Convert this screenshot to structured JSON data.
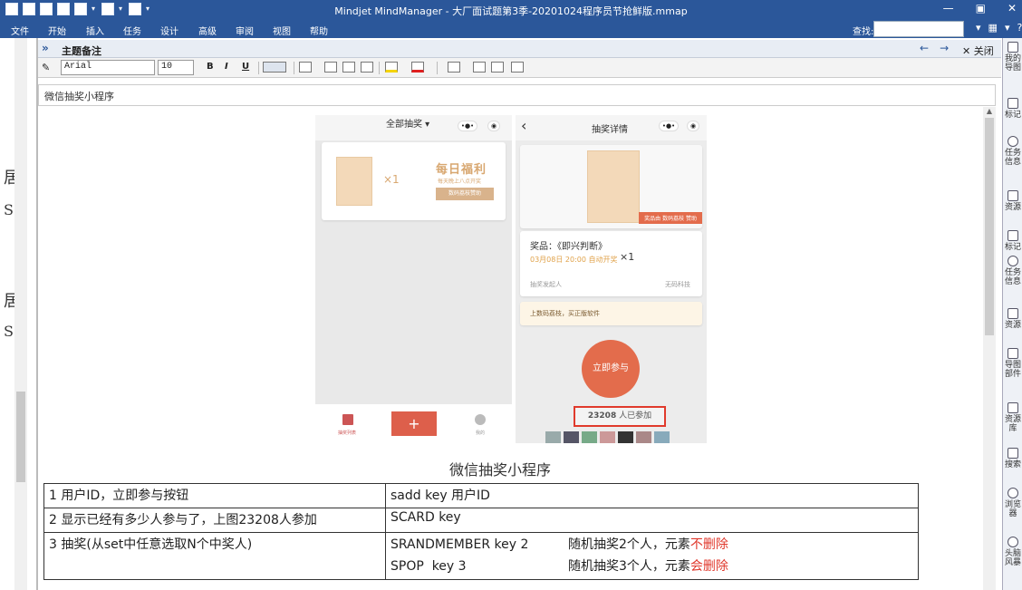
{
  "window": {
    "title": "Mindjet MindManager - 大厂面试题第3季-20201024程序员节抢鲜版.mmap",
    "controls": [
      "—",
      "▣",
      "✕"
    ]
  },
  "menu": [
    "文件",
    "开始",
    "插入",
    "任务",
    "设计",
    "高级",
    "审阅",
    "视图",
    "帮助"
  ],
  "search": {
    "label": "查找:",
    "value": ""
  },
  "notes_pane": {
    "title": "主题备注",
    "close_label": "关闭",
    "font": "Arial",
    "size": "10",
    "bold": "B",
    "italic": "I",
    "underline": "U"
  },
  "topic_title": "微信抽奖小程序",
  "left_fragments": [
    "居",
    "S",
    "居",
    "S"
  ],
  "right_sidebar": [
    "我的导图",
    "标记",
    "任务信息",
    "资源",
    "标记",
    "任务信息",
    "资源",
    "导图部件",
    "资源库",
    "搜索",
    "浏览器",
    "头脑风暴"
  ],
  "phone_a": {
    "title": "全部抽奖 ▾",
    "card_multiplier": "×1",
    "card_heading": "每日福利",
    "card_sub": "每天晚上八点开奖",
    "card_button": "数码荔枝赞助",
    "tab_list_label": "抽奖列表",
    "tab_plus": "+",
    "tab_me_label": "我的"
  },
  "phone_b": {
    "title": "抽奖详情",
    "back": "‹",
    "ribbon": "奖品由 数码荔枝 赞助",
    "prize": "奖品：《即兴判断》",
    "prize_multiplier": "×1",
    "draw_time": "03月08日 20:00 自动开奖",
    "initiator_label": "抽奖发起人",
    "initiator_name": "无码科技",
    "ad_text": "上数码荔枝，买正版软件",
    "join_button": "立即参与",
    "participants_count": "23208",
    "participants_suffix": "人已参加"
  },
  "figure_caption": "微信抽奖小程序",
  "command_table": [
    {
      "left": "1 用户ID，立即参与按钮",
      "right": "sadd key 用户ID"
    },
    {
      "left": "2 显示已经有多少人参与了，上图23208人参加",
      "right": "SCARD key"
    },
    {
      "left": "3 抽奖(从set中任意选取N个中奖人)",
      "right_lines": [
        {
          "cmd": "SRANDMEMBER key 2",
          "desc": "随机抽奖2个人，元素",
          "desc_red": "不删除"
        },
        {
          "cmd": "SPOP  key 3",
          "desc": "随机抽奖3个人，元素",
          "desc_red": "会删除"
        }
      ]
    }
  ],
  "colors": {
    "titlebar": "#2b579a",
    "highlight_red": "#e0382c",
    "join_button": "#e36c4c"
  }
}
